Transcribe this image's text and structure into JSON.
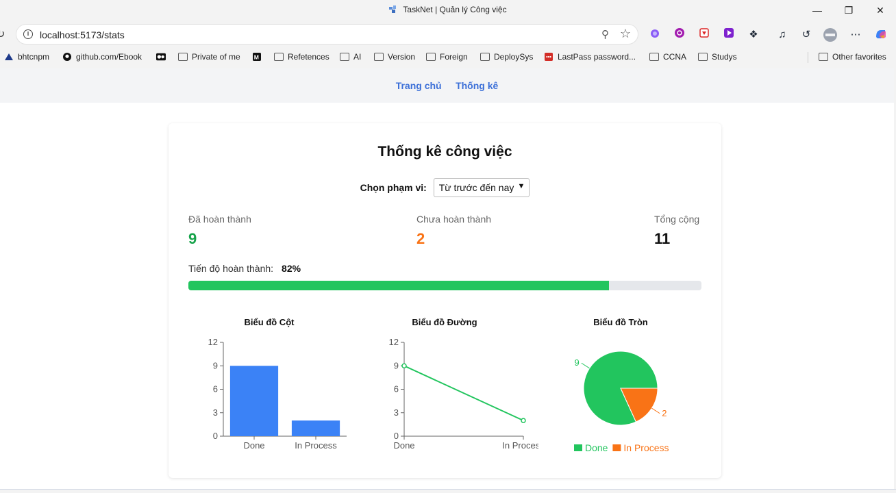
{
  "window": {
    "title": "TaskNet | Quản lý Công việc"
  },
  "browser": {
    "url": "localhost:5173/stats",
    "bookmarks": [
      {
        "label": "bhtcnpm"
      },
      {
        "label": "github.com/Ebook"
      },
      {
        "label": ""
      },
      {
        "label": "Private of me"
      },
      {
        "label": ""
      },
      {
        "label": "Refetences"
      },
      {
        "label": "AI"
      },
      {
        "label": "Version"
      },
      {
        "label": "Foreign"
      },
      {
        "label": "DeploySys"
      },
      {
        "label": "LastPass password..."
      },
      {
        "label": "CCNA"
      },
      {
        "label": "Studys"
      },
      {
        "label": "Other favorites"
      }
    ]
  },
  "nav": {
    "home": "Trang chủ",
    "stats": "Thống kê"
  },
  "page": {
    "title": "Thống kê công việc",
    "range_label": "Chọn phạm vi:",
    "range_value": "Từ trước đến nay"
  },
  "stats": {
    "done_label": "Đã hoàn thành",
    "done_value": "9",
    "pending_label": "Chưa hoàn thành",
    "pending_value": "2",
    "total_label": "Tổng cộng",
    "total_value": "11"
  },
  "progress": {
    "label": "Tiến độ hoàn thành:",
    "percent_text": "82%",
    "fraction": 0.82
  },
  "colors": {
    "done": "#22c55e",
    "in_process": "#f97316",
    "bar": "#3b82f6",
    "accent": "#3b6fd8"
  },
  "chart_data": [
    {
      "type": "bar",
      "title": "Biểu đồ Cột",
      "categories": [
        "Done",
        "In Process"
      ],
      "values": [
        9,
        2
      ],
      "yticks": [
        0,
        3,
        6,
        9,
        12
      ],
      "ylim": [
        0,
        12
      ]
    },
    {
      "type": "line",
      "title": "Biểu đồ Đường",
      "categories": [
        "Done",
        "In Process"
      ],
      "values": [
        9,
        2
      ],
      "yticks": [
        0,
        3,
        6,
        9,
        12
      ],
      "ylim": [
        0,
        12
      ]
    },
    {
      "type": "pie",
      "title": "Biểu đồ Tròn",
      "categories": [
        "Done",
        "In Process"
      ],
      "values": [
        9,
        2
      ],
      "legend": "bottom"
    }
  ]
}
